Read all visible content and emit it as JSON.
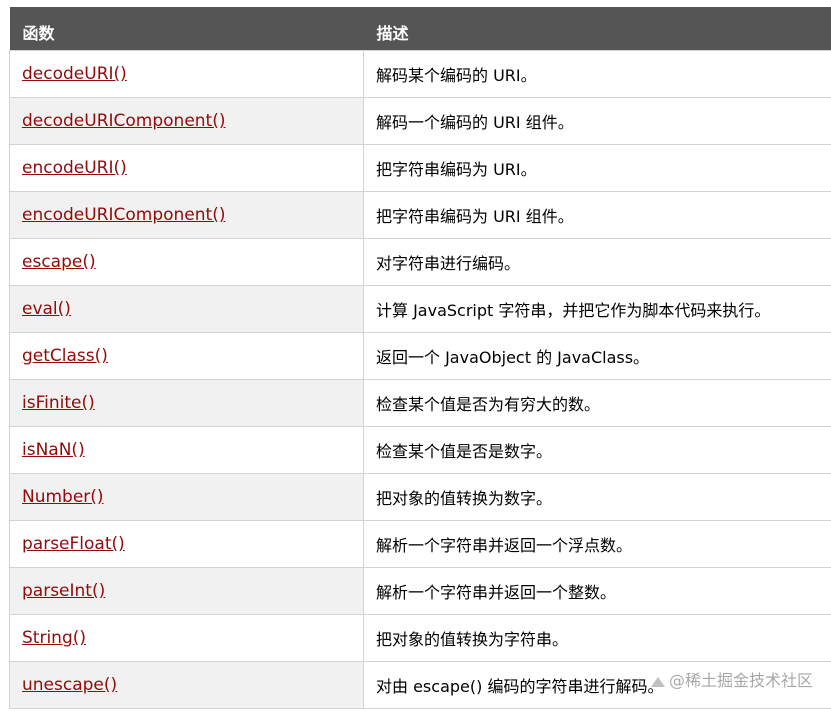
{
  "table": {
    "headers": [
      "函数",
      "描述"
    ],
    "rows": [
      {
        "function": "decodeURI()",
        "description": "解码某个编码的 URI。"
      },
      {
        "function": "decodeURIComponent()",
        "description": "解码一个编码的 URI 组件。"
      },
      {
        "function": "encodeURI()",
        "description": "把字符串编码为 URI。"
      },
      {
        "function": "encodeURIComponent()",
        "description": "把字符串编码为 URI 组件。"
      },
      {
        "function": "escape()",
        "description": "对字符串进行编码。"
      },
      {
        "function": "eval()",
        "description": "计算 JavaScript 字符串，并把它作为脚本代码来执行。"
      },
      {
        "function": "getClass()",
        "description": "返回一个 JavaObject 的 JavaClass。"
      },
      {
        "function": "isFinite()",
        "description": "检查某个值是否为有穷大的数。"
      },
      {
        "function": "isNaN()",
        "description": "检查某个值是否是数字。"
      },
      {
        "function": "Number()",
        "description": "把对象的值转换为数字。"
      },
      {
        "function": "parseFloat()",
        "description": "解析一个字符串并返回一个浮点数。"
      },
      {
        "function": "parseInt()",
        "description": "解析一个字符串并返回一个整数。"
      },
      {
        "function": "String()",
        "description": "把对象的值转换为字符串。"
      },
      {
        "function": "unescape()",
        "description": "对由 escape() 编码的字符串进行解码。"
      }
    ]
  },
  "watermark": {
    "text": "@稀土掘金技术社区",
    "icon": "juejin-logo-icon"
  },
  "colors": {
    "header_bg": "#555555",
    "link": "#900b09",
    "row_alt": "#f1f1f1"
  }
}
